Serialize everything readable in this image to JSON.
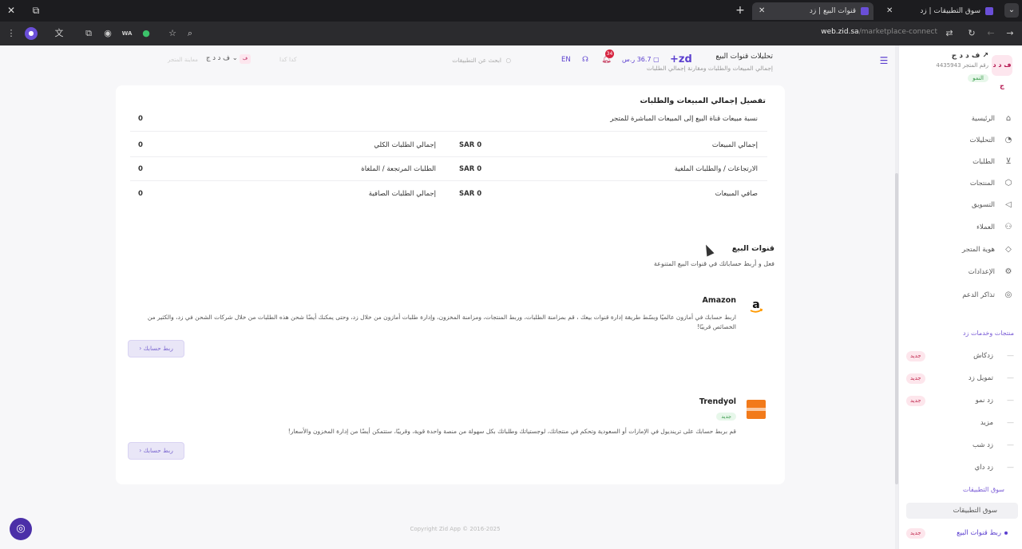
{
  "browser": {
    "tabs": [
      {
        "title": "سوق التطبيقات | زد",
        "active": false
      },
      {
        "title": "قنوات البيع | زد",
        "active": true
      }
    ],
    "url_host": "web.zid.sa",
    "url_path": "/marketplace-connect",
    "toolbar_badge": "WA"
  },
  "sidebar": {
    "store_logo": "ف د د ج",
    "store_name": "ف د د ج",
    "store_id": "رقم المتجر 4435943",
    "store_plan": "النمو",
    "items": [
      {
        "label": "الرئيسية",
        "icon": "home-icon"
      },
      {
        "label": "التحليلات",
        "icon": "analytics-icon"
      },
      {
        "label": "الطلبات",
        "icon": "cart-icon"
      },
      {
        "label": "المنتجات",
        "icon": "box-icon"
      },
      {
        "label": "التسويق",
        "icon": "megaphone-icon"
      },
      {
        "label": "العملاء",
        "icon": "users-icon"
      },
      {
        "label": "هوية المتجر",
        "icon": "brush-icon"
      },
      {
        "label": "الإعدادات",
        "icon": "gear-icon"
      },
      {
        "label": "تذاكر الدعم",
        "icon": "support-icon"
      }
    ],
    "services_heading": "منتجات وخدمات زد",
    "services": [
      {
        "label": "زدكاش",
        "badge": "جديد"
      },
      {
        "label": "تمويل زد",
        "badge": "جديد"
      },
      {
        "label": "زد نمو",
        "badge": "جديد"
      },
      {
        "label": "مزيد",
        "badge": ""
      },
      {
        "label": "زد شب",
        "badge": ""
      },
      {
        "label": "زد داي",
        "badge": ""
      }
    ],
    "marketplace_heading": "سوق التطبيقات",
    "marketplace_items": [
      {
        "label": "سوق التطبيقات",
        "badge": ""
      },
      {
        "label": "ربط قنوات البيع",
        "badge": "جديد"
      }
    ]
  },
  "header": {
    "title": "تحليلات قنوات البيع",
    "subtitle": "إجمالي المبيعات والطلبات ومقارنة إجمالي الطلبات",
    "logo": "+zd",
    "credit": "36.7 ر.س",
    "notifications": "34",
    "lang": "EN",
    "search_placeholder": "ابحث عن التطبيقات",
    "faint_text": "كدا كدا",
    "store_name": "ف د د ج",
    "preview_text": "معاينة المتجر"
  },
  "summary": {
    "title": "تفصيل إجمالي المبيعات والطلبات",
    "ratio_label": "نسبة مبيعات قناة البيع إلى المبيعات المباشرة للمتجر",
    "ratio_value": "0",
    "rows": [
      {
        "right_label": "إجمالي المبيعات",
        "right_value": "SAR 0",
        "left_label": "إجمالي الطلبات الكلي",
        "left_value": "0"
      },
      {
        "right_label": "الارتجاعات / والطلبات الملغية",
        "right_value": "SAR 0",
        "left_label": "الطلبات المرتجعة / الملغاة",
        "left_value": "0"
      },
      {
        "right_label": "صافي المبيعات",
        "right_value": "SAR 0",
        "left_label": "إجمالي الطلبات الصافية",
        "left_value": "0"
      }
    ]
  },
  "channels": {
    "title": "قنوات البيع",
    "subtitle": "فعل و أربط حساباتك في قنوات البيع المتنوعة",
    "items": [
      {
        "name": "Amazon",
        "badge": "",
        "description": "اربط حسابك في أمازون عالميًا وبسّط طريقة إدارة قنوات بيعك ، قم بمزامنة الطلبات، وربط المنتجات، ومزامنة المخزون، وإدارة طلبات أمازون من خلال زد، وحتى يمكنك أيضًا شحن هذه الطلبات من خلال شركات الشحن في زد، والكثير من الخصائص قريبًا!",
        "button": "ربط حسابك"
      },
      {
        "name": "Trendyol",
        "badge": "جديد",
        "description": "قم بربط حسابك على ترينديول في الإمارات أو السعودية وتحكم في منتجاتك، لوجستياتك وطلباتك بكل سهولة من منصة واحدة قوية، وقريبًا، ستتمكن أيضًا من إدارة المخزون والأسعار!",
        "button": "ربط حسابك"
      }
    ]
  },
  "footer": "Copyright Zid App © 2016-2025",
  "colors": {
    "accent": "#5b3fcf",
    "badge_new": "#c0284e",
    "badge_green": "#3a9b4c"
  }
}
